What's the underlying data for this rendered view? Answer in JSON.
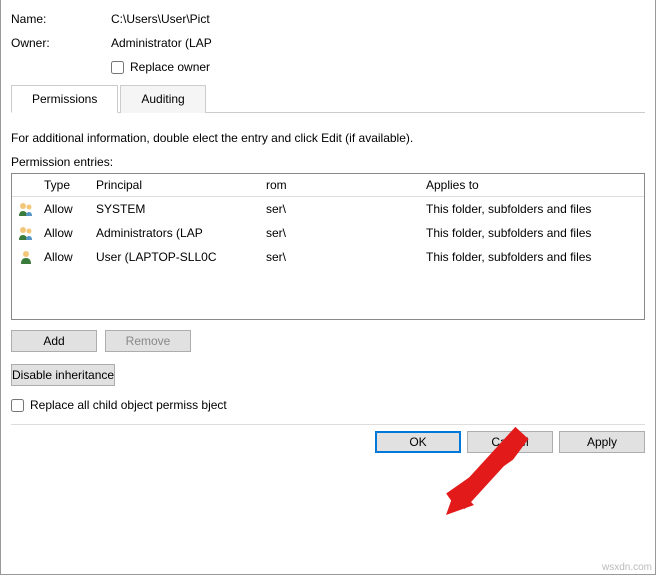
{
  "fields": {
    "name_label": "Name:",
    "name_value": "C:\\Users\\User\\Pict",
    "owner_label": "Owner:",
    "owner_value": "Administrator (LAP",
    "replace_owner_label": "Replace owner"
  },
  "tabs": {
    "permissions": "Permissions",
    "auditing": "Auditing"
  },
  "instructions_text": "For additional information, double         elect the entry and click Edit (if available).",
  "entries_label": "Permission entries:",
  "entries": {
    "headers": {
      "type": "Type",
      "principal": "Principal",
      "from": "rom",
      "applies_to": "Applies to"
    },
    "rows": [
      {
        "type": "Allow",
        "principal": "SYSTEM",
        "from": "ser\\",
        "applies_to": "This folder, subfolders and files"
      },
      {
        "type": "Allow",
        "principal": "Administrators (LAP",
        "from": "ser\\",
        "applies_to": "This folder, subfolders and files"
      },
      {
        "type": "Allow",
        "principal": "User (LAPTOP-SLL0C",
        "from": "ser\\",
        "applies_to": "This folder, subfolders and files"
      }
    ]
  },
  "buttons": {
    "add": "Add",
    "remove": "Remove",
    "disable_inheritance": "Disable inheritance",
    "ok": "OK",
    "cancel": "Cancel",
    "apply": "Apply"
  },
  "replace_child_label": "Replace all child object permiss         bject",
  "watermark": "wsxdn.com"
}
